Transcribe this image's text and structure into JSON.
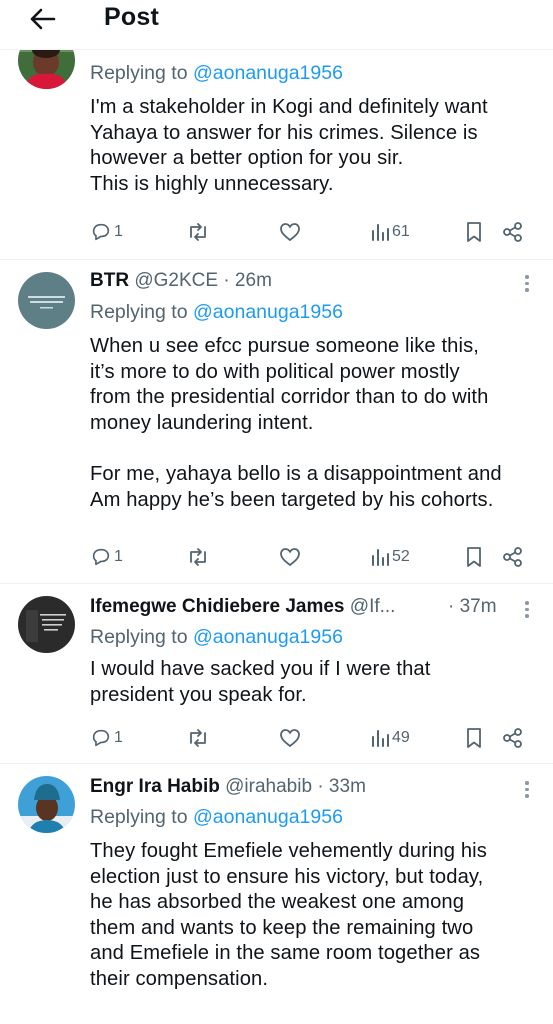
{
  "header": {
    "title": "Post"
  },
  "tweets": [
    {
      "name": "",
      "handle": "",
      "time": "",
      "replying_label": "Replying to",
      "replying_handle": "@aonanuga1956",
      "lines": [
        "I'm a stakeholder in Kogi and definitely want",
        "Yahaya to answer for his crimes. Silence is",
        "however a better option for you sir.",
        "This is highly unnecessary."
      ],
      "replies": "1",
      "views": "61"
    },
    {
      "name": "BTR",
      "handle": "@G2KCE",
      "time": "· 26m",
      "replying_label": "Replying to",
      "replying_handle": "@aonanuga1956",
      "lines": [
        "When u see efcc pursue someone like this,",
        "it’s more to do with political power mostly",
        "from the presidential corridor than to do with",
        "money laundering intent.",
        "",
        "For me, yahaya bello is a disappointment and",
        "Am happy he’s been targeted by his cohorts."
      ],
      "replies": "1",
      "views": "52"
    },
    {
      "name": "Ifemegwe Chidiebere James",
      "handle": "@If...",
      "time": "· 37m",
      "replying_label": "Replying to",
      "replying_handle": "@aonanuga1956",
      "lines": [
        "I would have sacked you if I were that",
        "president you speak for."
      ],
      "replies": "1",
      "views": "49"
    },
    {
      "name": "Engr Ira Habib",
      "handle": "@irahabib",
      "time": "· 33m",
      "replying_label": "Replying to",
      "replying_handle": "@aonanuga1956",
      "lines": [
        "They fought Emefiele vehemently during his",
        "election just to ensure his victory, but today,",
        "he has absorbed the weakest one among",
        "them and wants to keep the remaining two",
        "and Emefiele in the same room together as",
        "their compensation."
      ]
    }
  ],
  "colors": {
    "accent": "#1d9bf0",
    "secondary": "#536471",
    "text": "#0f1419"
  },
  "icons": [
    "back-arrow-icon",
    "reply-icon",
    "repost-icon",
    "like-icon",
    "views-icon",
    "bookmark-icon",
    "share-icon",
    "more-icon"
  ]
}
